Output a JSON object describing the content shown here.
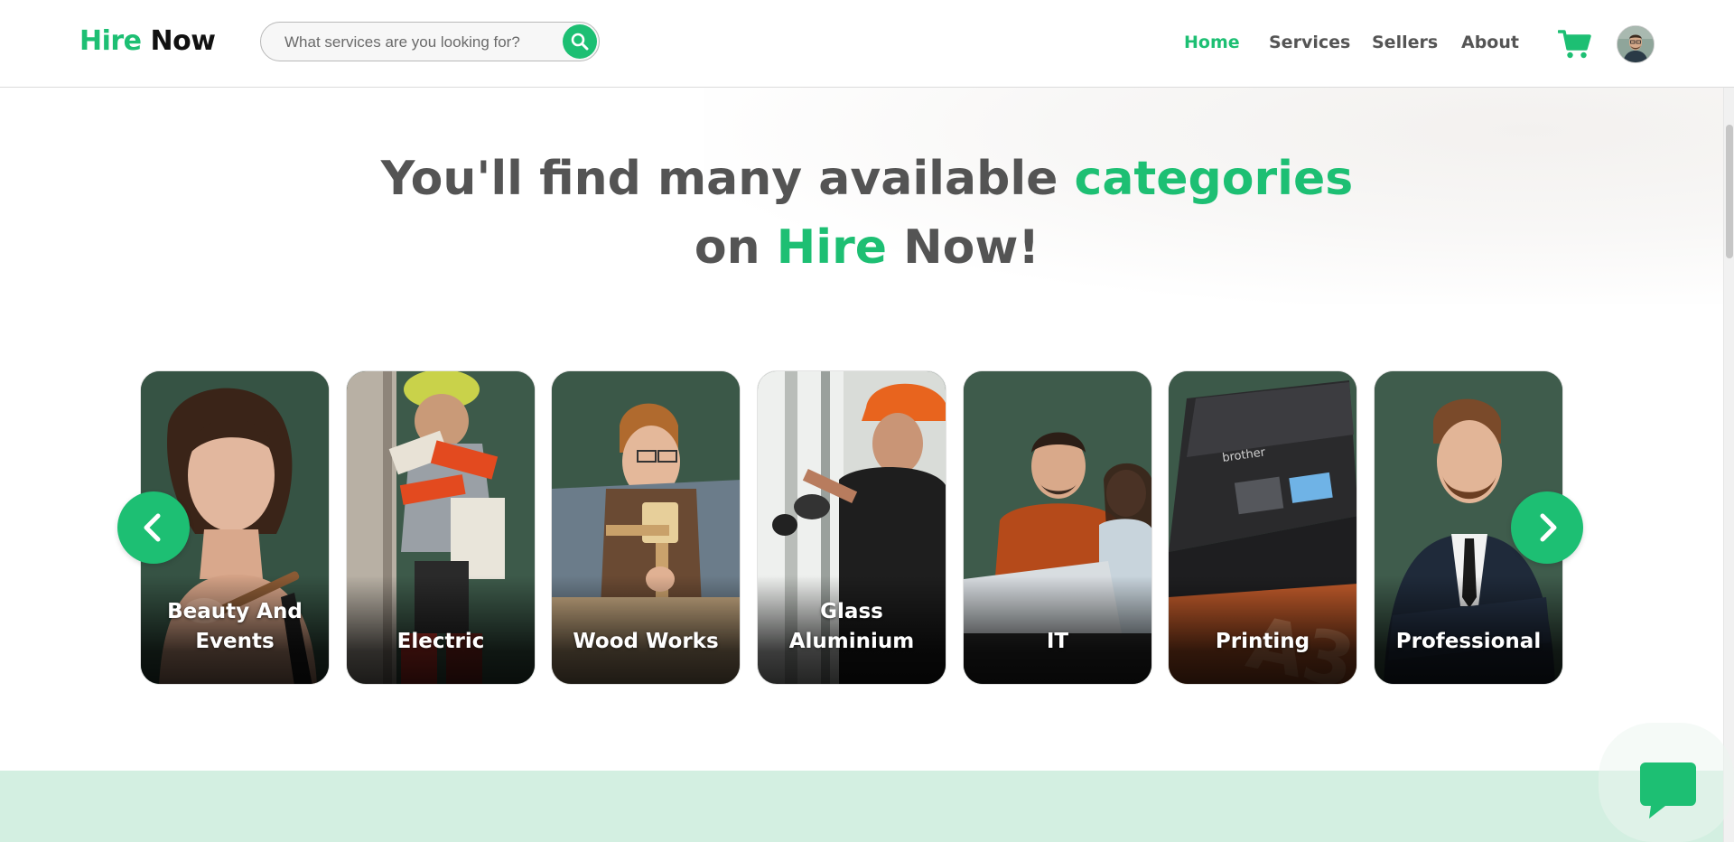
{
  "brand": {
    "part1": "Hire",
    "part2": "Now"
  },
  "search": {
    "placeholder": "What services are you looking for?",
    "button_icon": "search-icon"
  },
  "nav": {
    "items": [
      "Home",
      "Services",
      "Sellers",
      "About"
    ],
    "active": "Home"
  },
  "header_icons": {
    "cart": "cart-icon",
    "avatar": "user-avatar"
  },
  "headline": {
    "line1_pre": "You'll find many available ",
    "line1_highlight": "categories",
    "line2_pre": "on ",
    "line2_highlight": "Hire",
    "line2_post": " Now!"
  },
  "categories": [
    "Beauty And Events",
    "Electric",
    "Wood Works",
    "Glass Aluminium",
    "IT",
    "Printing",
    "Professional"
  ],
  "carousel": {
    "prev_icon": "chevron-left-icon",
    "next_icon": "chevron-right-icon"
  },
  "chat": {
    "icon": "chat-bubble-icon"
  },
  "colors": {
    "accent": "#1dbf73",
    "heading": "#545454",
    "nav_text": "#555555",
    "band": "#d3efe1"
  }
}
